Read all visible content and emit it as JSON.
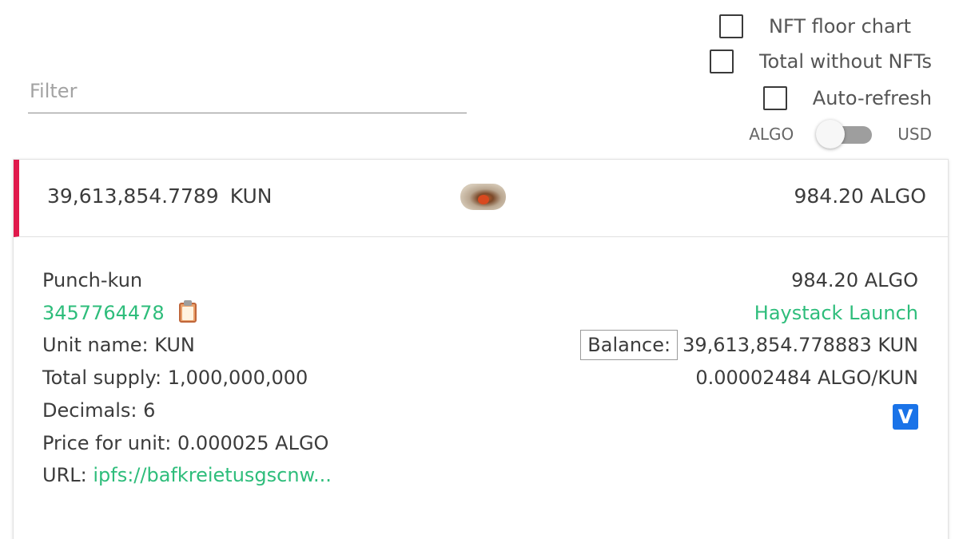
{
  "filter": {
    "placeholder": "Filter",
    "value": ""
  },
  "options": {
    "nft_floor_chart": {
      "label": "NFT floor chart",
      "checked": false
    },
    "total_without_nfts": {
      "label": "Total without NFTs",
      "checked": false
    },
    "auto_refresh": {
      "label": "Auto-refresh",
      "checked": false
    }
  },
  "currency_toggle": {
    "left_label": "ALGO",
    "right_label": "USD",
    "selected": "ALGO"
  },
  "asset": {
    "header": {
      "amount": "39,613,854.7789",
      "unit": "KUN",
      "value": "984.20 ALGO",
      "accent_color": "#e0184b"
    },
    "name": "Punch-kun",
    "asset_id": "3457764478",
    "unit_name": "Unit name: KUN",
    "total_supply": "Total supply: 1,000,000,000",
    "decimals": "Decimals: 6",
    "price_for_unit": "Price for unit: 0.000025 ALGO",
    "url_label": "URL:",
    "url": "ipfs://bafkreietusgscnw...",
    "value_algo": "984.20 ALGO",
    "source_link": "Haystack Launch",
    "balance_label": "Balance:",
    "balance_value": "39,613,854.778883 KUN",
    "price_per_unit": "0.00002484 ALGO/KUN",
    "icons": {
      "copy": "clipboard-icon",
      "explorer": "vestige-icon",
      "thumbnail": "asset-thumbnail"
    }
  },
  "colors": {
    "link_green": "#2ebd7b",
    "accent_red": "#e0184b",
    "explorer_blue": "#1a73e8"
  }
}
